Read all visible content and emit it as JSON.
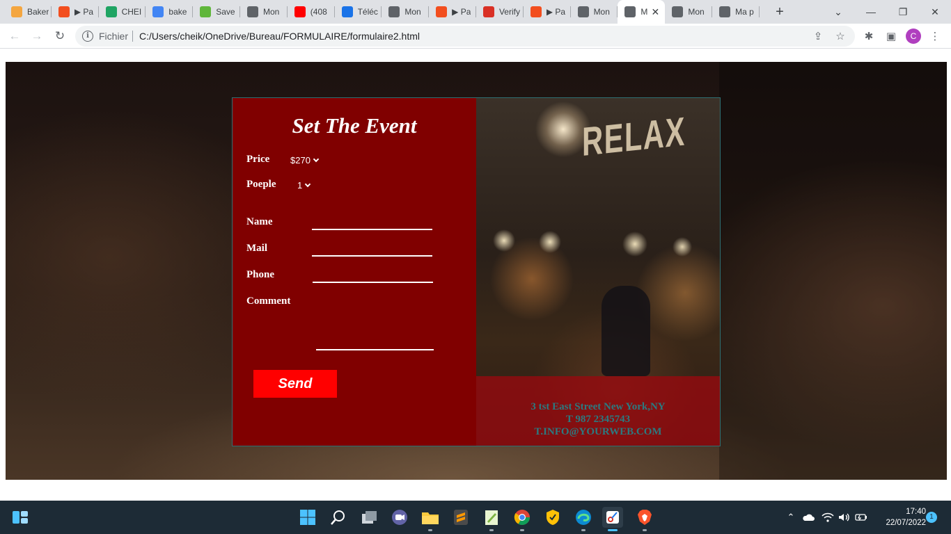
{
  "browser": {
    "tabs": [
      {
        "label": "Baker",
        "icon": "bakery-icon",
        "color": "#f4a640"
      },
      {
        "label": "▶ Pa",
        "icon": "figma-icon",
        "color": "#f24e1e"
      },
      {
        "label": "CHEI",
        "icon": "google-drive-icon",
        "color": "#1fa463"
      },
      {
        "label": "bake",
        "icon": "google-search-icon",
        "color": "#4285f4"
      },
      {
        "label": "Save",
        "icon": "download-icon",
        "color": "#5fb63b"
      },
      {
        "label": "Mon",
        "icon": "globe-icon",
        "color": "#5f6368"
      },
      {
        "label": "(408",
        "icon": "youtube-icon",
        "color": "#ff0000"
      },
      {
        "label": "Téléc",
        "icon": "download-icon",
        "color": "#1a73e8"
      },
      {
        "label": "Mon",
        "icon": "globe-icon",
        "color": "#5f6368"
      },
      {
        "label": "▶ Pa",
        "icon": "figma-icon",
        "color": "#f24e1e"
      },
      {
        "label": "Verify",
        "icon": "gmail-icon",
        "color": "#d93025"
      },
      {
        "label": "▶ Pa",
        "icon": "figma-icon",
        "color": "#f24e1e"
      },
      {
        "label": "Mon",
        "icon": "globe-icon",
        "color": "#5f6368"
      },
      {
        "label": "M",
        "icon": "globe-icon",
        "color": "#5f6368",
        "active": true
      },
      {
        "label": "Mon",
        "icon": "globe-icon",
        "color": "#5f6368"
      },
      {
        "label": "Ma p",
        "icon": "globe-icon",
        "color": "#5f6368"
      }
    ],
    "new_tab": "+",
    "address": {
      "scheme": "Fichier",
      "url": "C:/Users/cheik/OneDrive/Bureau/FORMULAIRE/formulaire2.html"
    },
    "profile_initial": "C"
  },
  "form": {
    "title": "Set The Event",
    "price_label": "Price",
    "price_value": "$270",
    "people_label": "Poeple",
    "people_value": "1",
    "name_label": "Name",
    "mail_label": "Mail",
    "phone_label": "Phone",
    "comment_label": "Comment",
    "send_label": "Send"
  },
  "photo": {
    "sign_text": "RELAX"
  },
  "contact": {
    "address": "3 tst East Street New York,NY",
    "phone": "T 987 2345743",
    "email": "T.INFO@YOURWEB.COM"
  },
  "colors": {
    "form_bg": "#800000",
    "send_bg": "#ff0000",
    "contact_text": "#2b7a80"
  },
  "taskbar": {
    "time": "17:40",
    "date": "22/07/2022",
    "notifications": "1"
  }
}
